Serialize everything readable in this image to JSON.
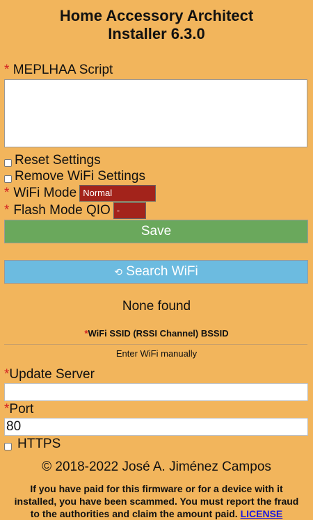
{
  "header": {
    "title_line1": "Home Accessory Architect",
    "title_line2": "Installer 6.3.0"
  },
  "required_marker": "*",
  "script": {
    "label": "MEPLHAA Script",
    "value": ""
  },
  "reset_settings": {
    "label": "Reset Settings",
    "checked": false
  },
  "remove_wifi": {
    "label": "Remove WiFi Settings",
    "checked": false
  },
  "wifi_mode": {
    "label": "WiFi Mode",
    "selected": "Normal"
  },
  "flash_mode": {
    "label": "Flash Mode QIO",
    "selected": "-"
  },
  "save_button": {
    "label": "Save",
    "color": "#6aa85c"
  },
  "search_button": {
    "icon": "⟲",
    "label": "Search WiFi",
    "color": "#6cbbe0"
  },
  "wifi": {
    "status": "None found",
    "ssid_header": "WiFi SSID (RSSI Channel) BSSID",
    "manual_link": "Enter WiFi manually"
  },
  "update_server": {
    "label": "Update Server",
    "value": ""
  },
  "port": {
    "label": "Port",
    "value": "80"
  },
  "https": {
    "label": "HTTPS",
    "checked": false
  },
  "copyright": "© 2018-2022 José A. Jiménez Campos",
  "warning": {
    "line1": "If you have paid for this firmware or for a device with it",
    "line2": "installed, you have been scammed. You must report the fraud",
    "line3": "to the authorities and claim the amount paid.",
    "license_link": "LICENSE"
  },
  "colors": {
    "background": "#f2b55c",
    "required": "#d32222",
    "select_bg": "#a3231b",
    "link": "#1a1adf"
  }
}
